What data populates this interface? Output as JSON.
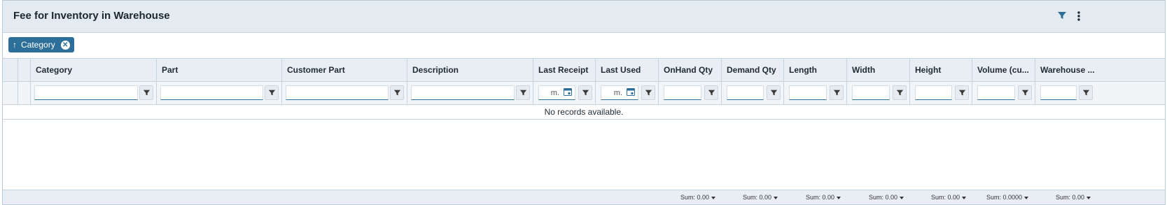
{
  "window": {
    "title": "Fee for Inventory in Warehouse"
  },
  "toolbar": {
    "filter_icon": "filter-icon",
    "more_icon": "more-vertical-icon"
  },
  "grouping": {
    "chip_label": "Category",
    "chip_arrow": "↑"
  },
  "columns": [
    {
      "label": "Category"
    },
    {
      "label": "Part"
    },
    {
      "label": "Customer Part"
    },
    {
      "label": "Description"
    },
    {
      "label": "Last Receipt"
    },
    {
      "label": "Last Used"
    },
    {
      "label": "OnHand Qty"
    },
    {
      "label": "Demand Qty"
    },
    {
      "label": "Length"
    },
    {
      "label": "Width"
    },
    {
      "label": "Height"
    },
    {
      "label": "Volume (cu..."
    },
    {
      "label": "Warehouse ..."
    }
  ],
  "filters": {
    "last_receipt_placeholder": "m.",
    "last_used_placeholder": "m."
  },
  "table": {
    "empty_message": "No records available."
  },
  "footer": {
    "sums": [
      "Sum: 0.00",
      "Sum: 0.00",
      "Sum: 0.00",
      "Sum: 0.00",
      "Sum: 0.00",
      "Sum: 0.0000",
      "Sum: 0.00"
    ]
  },
  "colors": {
    "accent": "#2d6f99",
    "header_bg": "#e3ebf1",
    "border": "#c6d4df"
  }
}
